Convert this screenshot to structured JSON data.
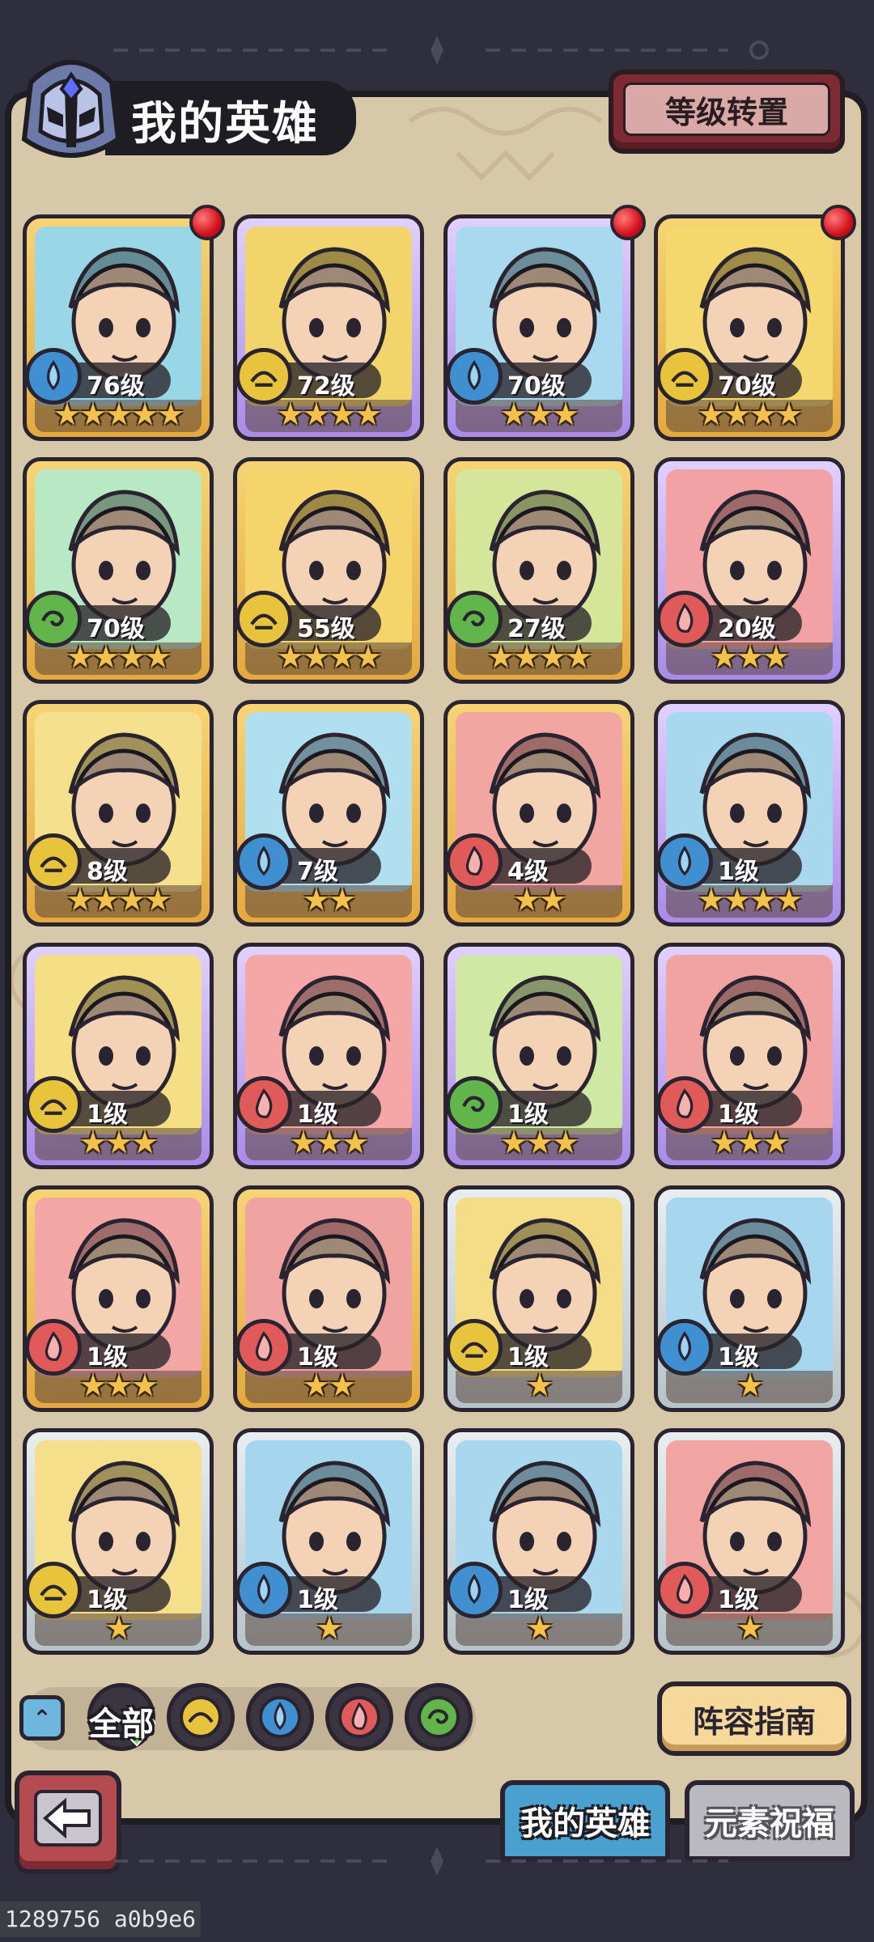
{
  "header": {
    "title": "我的英雄",
    "level_reset_label": "等级转置"
  },
  "heroes": [
    {
      "level": "76级",
      "stars": "★★★★★",
      "element": "water",
      "frame": "gold",
      "dot": true,
      "bg": "#9ad7e6"
    },
    {
      "level": "72级",
      "stars": "★★★★",
      "element": "earth",
      "frame": "purple",
      "dot": false,
      "bg": "#f2d56a"
    },
    {
      "level": "70级",
      "stars": "★★★",
      "element": "water",
      "frame": "purple",
      "dot": true,
      "bg": "#a9d9ef"
    },
    {
      "level": "70级",
      "stars": "★★★★",
      "element": "earth",
      "frame": "gold",
      "dot": true,
      "bg": "#f4d86e"
    },
    {
      "level": "70级",
      "stars": "★★★★",
      "element": "wind",
      "frame": "gold",
      "dot": false,
      "bg": "#b9e8c5"
    },
    {
      "level": "55级",
      "stars": "★★★★",
      "element": "earth",
      "frame": "gold",
      "dot": false,
      "bg": "#f5d56b"
    },
    {
      "level": "27级",
      "stars": "★★★★",
      "element": "wind",
      "frame": "gold",
      "dot": false,
      "bg": "#d5e59a"
    },
    {
      "level": "20级",
      "stars": "★★★",
      "element": "fire",
      "frame": "purple",
      "dot": false,
      "bg": "#f2a2a4"
    },
    {
      "level": "8级",
      "stars": "★★★★",
      "element": "earth",
      "frame": "gold",
      "dot": false,
      "bg": "#f5e08d"
    },
    {
      "level": "7级",
      "stars": "★★",
      "element": "water",
      "frame": "gold",
      "dot": false,
      "bg": "#b0dff0"
    },
    {
      "level": "4级",
      "stars": "★★",
      "element": "fire",
      "frame": "gold",
      "dot": false,
      "bg": "#f1a6a2"
    },
    {
      "level": "1级",
      "stars": "★★★★",
      "element": "water",
      "frame": "purple",
      "dot": false,
      "bg": "#a8d8ee"
    },
    {
      "level": "1级",
      "stars": "★★★",
      "element": "earth",
      "frame": "purple",
      "dot": false,
      "bg": "#f5df84"
    },
    {
      "level": "1级",
      "stars": "★★★",
      "element": "fire",
      "frame": "purple",
      "dot": false,
      "bg": "#f4a7a6"
    },
    {
      "level": "1级",
      "stars": "★★★",
      "element": "wind",
      "frame": "purple",
      "dot": false,
      "bg": "#cfe9a5"
    },
    {
      "level": "1级",
      "stars": "★★★",
      "element": "fire",
      "frame": "purple",
      "dot": false,
      "bg": "#f1a3a1"
    },
    {
      "level": "1级",
      "stars": "★★★",
      "element": "fire",
      "frame": "gold",
      "dot": false,
      "bg": "#f3a7a5"
    },
    {
      "level": "1级",
      "stars": "★★",
      "element": "fire",
      "frame": "gold",
      "dot": false,
      "bg": "#f0a4a2"
    },
    {
      "level": "1级",
      "stars": "★",
      "element": "earth",
      "frame": "grey",
      "dot": false,
      "bg": "#f4dd86"
    },
    {
      "level": "1级",
      "stars": "★",
      "element": "water",
      "frame": "grey",
      "dot": false,
      "bg": "#a7d7ee"
    },
    {
      "level": "1级",
      "stars": "★",
      "element": "earth",
      "frame": "grey",
      "dot": false,
      "bg": "#f5df8a"
    },
    {
      "level": "1级",
      "stars": "★",
      "element": "water",
      "frame": "grey",
      "dot": false,
      "bg": "#a6d6ee"
    },
    {
      "level": "1级",
      "stars": "★",
      "element": "water",
      "frame": "grey",
      "dot": false,
      "bg": "#a9d7ee"
    },
    {
      "level": "1级",
      "stars": "★",
      "element": "fire",
      "frame": "grey",
      "dot": false,
      "bg": "#f1a5a3"
    }
  ],
  "filters": {
    "all_label": "全部",
    "elements": [
      "earth",
      "water",
      "fire",
      "wind"
    ]
  },
  "element_colors": {
    "water": "#3f8fd1",
    "earth": "#e8c43c",
    "fire": "#e05a5a",
    "wind": "#62b54a"
  },
  "buttons": {
    "guide_label": "阵容指南"
  },
  "tabs": {
    "my_heroes": "我的英雄",
    "element_blessing": "元素祝福"
  },
  "footer": {
    "id_text": "1289756 a0b9e6"
  }
}
